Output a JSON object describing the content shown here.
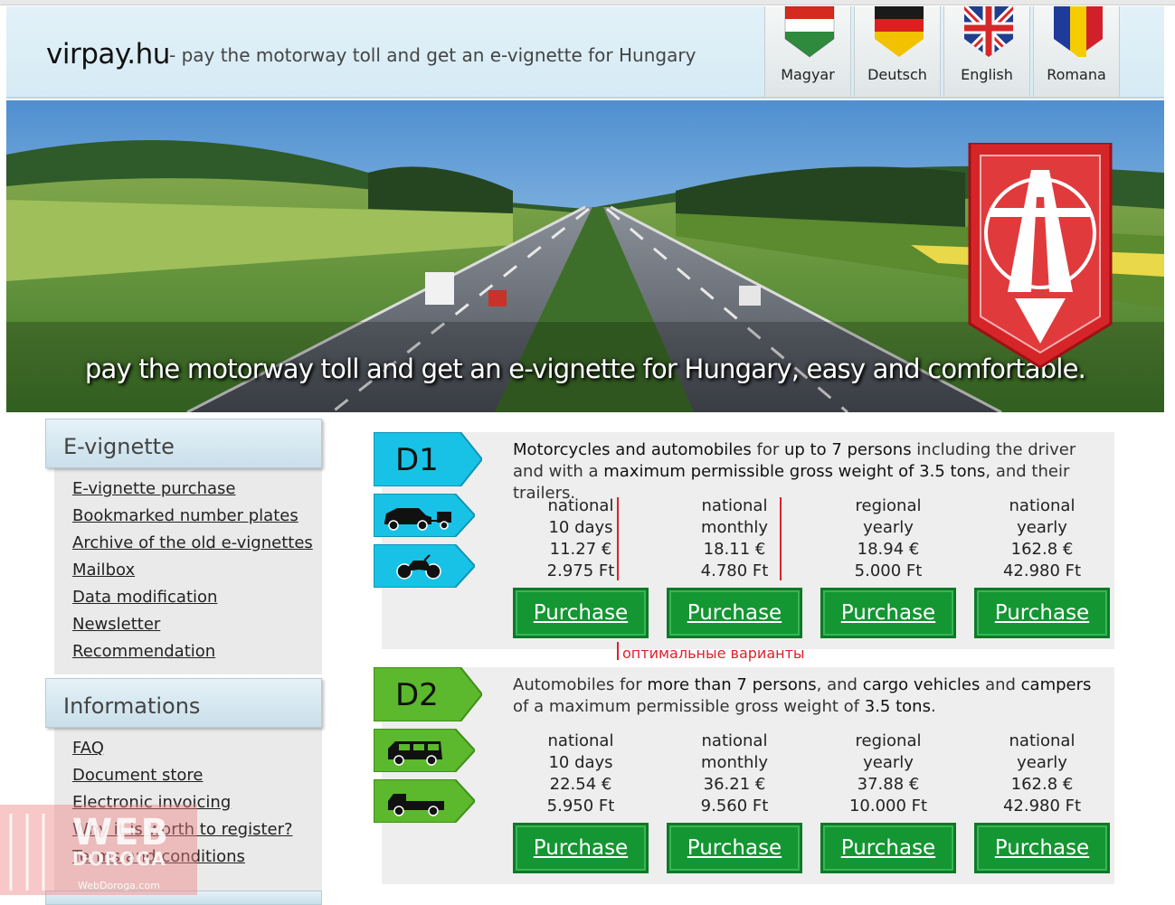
{
  "header": {
    "site_title": "virpay.hu",
    "tagline": "- pay the motorway toll and get an e-vignette for Hungary"
  },
  "languages": [
    {
      "name": "Magyar",
      "flag": "hungary-flag-icon"
    },
    {
      "name": "Deutsch",
      "flag": "germany-flag-icon"
    },
    {
      "name": "English",
      "flag": "uk-flag-icon"
    },
    {
      "name": "Romana",
      "flag": "romania-flag-icon"
    }
  ],
  "hero": {
    "tagline": "pay the motorway toll and get an e-vignette for Hungary, easy and comfortable."
  },
  "sidebar": {
    "evignette": {
      "title": "E-vignette",
      "links": [
        "E-vignette purchase",
        "Bookmarked number plates",
        "Archive of the old e-vignettes",
        "Mailbox",
        "Data modification",
        "Newsletter",
        "Recommendation"
      ]
    },
    "informations": {
      "title": "Informations",
      "links": [
        "FAQ",
        "Document store",
        "Electronic invoicing",
        "Why it is worth to register?",
        "Terms and conditions"
      ]
    }
  },
  "categories": [
    {
      "code": "D1",
      "color": "#18c2e6",
      "description_parts": [
        "Motorcycles and automobiles",
        " for ",
        "up to 7 persons",
        " including the driver and with a ",
        "maximum permissible gross weight of 3.5 tons",
        ", and their trailers."
      ],
      "icons": [
        "car-with-trailer-icon",
        "motorcycle-icon"
      ],
      "options": [
        {
          "type": "national",
          "period": "10 days",
          "eur": "11.27 €",
          "huf": "2.975 Ft",
          "button": "Purchase"
        },
        {
          "type": "national",
          "period": "monthly",
          "eur": "18.11 €",
          "huf": "4.780 Ft",
          "button": "Purchase"
        },
        {
          "type": "regional",
          "period": "yearly",
          "eur": "18.94 €",
          "huf": "5.000 Ft",
          "button": "Purchase"
        },
        {
          "type": "national",
          "period": "yearly",
          "eur": "162.8 €",
          "huf": "42.980 Ft",
          "button": "Purchase"
        }
      ]
    },
    {
      "code": "D2",
      "color": "#5cb82c",
      "description_parts": [
        "Automobiles for ",
        "more than 7 persons",
        ", and ",
        "cargo vehicles",
        " and ",
        "campers",
        " of a maximum permissible gross weight of ",
        "3.5 tons",
        "."
      ],
      "icons": [
        "van-icon",
        "pickup-truck-icon"
      ],
      "options": [
        {
          "type": "national",
          "period": "10 days",
          "eur": "22.54 €",
          "huf": "5.950 Ft",
          "button": "Purchase"
        },
        {
          "type": "national",
          "period": "monthly",
          "eur": "36.21 €",
          "huf": "9.560 Ft",
          "button": "Purchase"
        },
        {
          "type": "regional",
          "period": "yearly",
          "eur": "37.88 €",
          "huf": "10.000 Ft",
          "button": "Purchase"
        },
        {
          "type": "national",
          "period": "yearly",
          "eur": "162.8 €",
          "huf": "42.980 Ft",
          "button": "Purchase"
        }
      ]
    }
  ],
  "annotation": {
    "text": "оптимальные варианты",
    "color": "#e0202c"
  },
  "watermark": {
    "text": "WEB",
    "text2": "DOROGA",
    "sub": "WebDoroga.com"
  }
}
